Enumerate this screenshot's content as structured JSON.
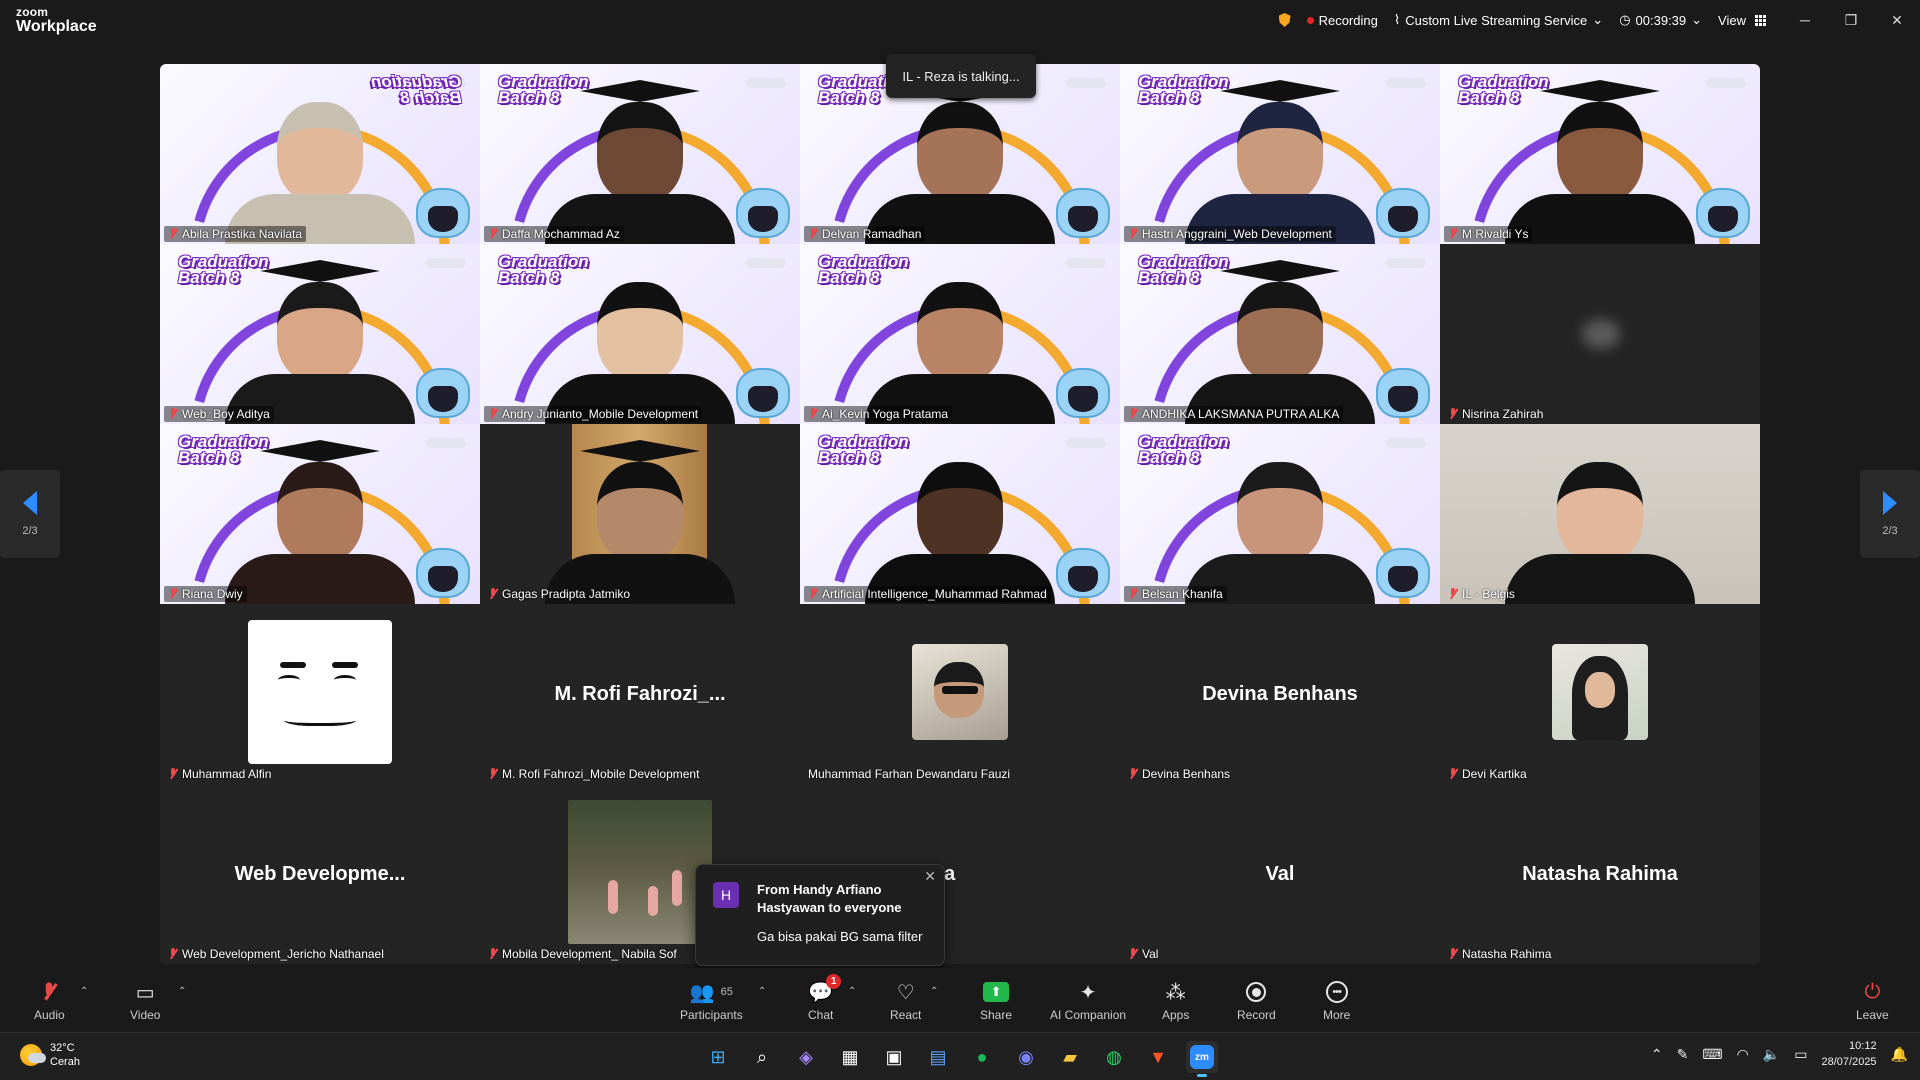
{
  "app": {
    "brand_top": "zoom",
    "brand_bottom": "Workplace"
  },
  "topbar": {
    "recording": "Recording",
    "streaming": "Custom Live Streaming Service",
    "timer": "00:39:39",
    "view": "View"
  },
  "talking_indicator": "IL - Reza is talking...",
  "video_badge": {
    "line1": "Graduation",
    "line2": "Batch 8"
  },
  "tiles": [
    {
      "name": "Abila Prastika Navilata",
      "kind": "video",
      "skin": "#e2b89a",
      "hair": "#c7c0b0",
      "cap": false,
      "flip": true
    },
    {
      "name": "Daffa Mochammad Az",
      "kind": "video",
      "skin": "#6e4a36",
      "hair": "#141414",
      "cap": true
    },
    {
      "name": "Delvan Ramadhan",
      "kind": "video",
      "skin": "#a57458",
      "hair": "#111111",
      "cap": true
    },
    {
      "name": "Hastri Anggraini_Web Development",
      "kind": "video",
      "skin": "#c99a7c",
      "hair": "#1f2540",
      "cap": true
    },
    {
      "name": "M Rivaldi Ys",
      "kind": "video",
      "skin": "#8a5a3e",
      "hair": "#111111",
      "cap": true
    },
    {
      "name": "Web_Boy Aditya",
      "kind": "video",
      "skin": "#d9a786",
      "hair": "#1a1a1a",
      "cap": true
    },
    {
      "name": "Andry Junianto_Mobile Development",
      "kind": "video",
      "skin": "#e2c0a0",
      "hair": "#111111",
      "cap": false
    },
    {
      "name": "Ai_Kevin Yoga Pratama",
      "kind": "video",
      "skin": "#b98466",
      "hair": "#111111",
      "cap": false
    },
    {
      "name": "ANDHIKA LAKSMANA PUTRA ALKA",
      "kind": "video",
      "skin": "#9c6e54",
      "hair": "#151515",
      "cap": true
    },
    {
      "name": "Nisrina Zahirah",
      "kind": "blank"
    },
    {
      "name": "Riana Dwiy",
      "kind": "video",
      "skin": "#b07a5c",
      "hair": "#2a1a18",
      "cap": true
    },
    {
      "name": "Gagas Pradipta Jatmiko",
      "kind": "wood",
      "skin": "#b4896a",
      "hair": "#111111",
      "cap": true
    },
    {
      "name": "Artificial Intelligence_Muhammad Rahmad",
      "kind": "video",
      "skin": "#4e3324",
      "hair": "#0e0e0e",
      "cap": false
    },
    {
      "name": "Belsan Khanifa",
      "kind": "video",
      "skin": "#c9957a",
      "hair": "#1b1b1b",
      "cap": false
    },
    {
      "name": "IL - Belgis",
      "kind": "photo",
      "skin": "#e3b79c",
      "hair": "#151515",
      "cap": false
    },
    {
      "name": "Muhammad Alfin",
      "kind": "avatar-face"
    },
    {
      "name": "M. Rofi Fahrozi_Mobile Development",
      "kind": "initials",
      "display": "M.  Rofi  Fahrozi_..."
    },
    {
      "name": "Muhammad Farhan Dewandaru Fauzi",
      "kind": "avatar-photo",
      "muted": false
    },
    {
      "name": "Devina Benhans",
      "kind": "initials",
      "display": "Devina Benhans"
    },
    {
      "name": "Devi Kartika",
      "kind": "avatar-hijab"
    },
    {
      "name": "Web Development_Jericho Nathanael",
      "kind": "initials",
      "display": "Web  Developme..."
    },
    {
      "name": "Mobila Development_ Nabila Sof",
      "kind": "avatar-garden"
    },
    {
      "name": "",
      "kind": "initials",
      "display": "t Tanjaya",
      "hide_plate": true
    },
    {
      "name": "Val",
      "kind": "initials",
      "display": "Val"
    },
    {
      "name": "Natasha Rahima",
      "kind": "initials",
      "display": "Natasha Rahima"
    }
  ],
  "pager": {
    "left": "2/3",
    "right": "2/3"
  },
  "chat_popup": {
    "avatar": "H",
    "from": "From Handy Arfiano Hastyawan to everyone",
    "message": "Ga bisa pakai BG sama filter"
  },
  "toolbar": {
    "audio": "Audio",
    "video": "Video",
    "participants": "Participants",
    "participants_count": "65",
    "chat": "Chat",
    "chat_badge": "1",
    "react": "React",
    "share": "Share",
    "ai_companion": "AI Companion",
    "apps": "Apps",
    "record": "Record",
    "more": "More",
    "leave": "Leave"
  },
  "taskbar": {
    "temp": "32°C",
    "weather": "Cerah",
    "time": "10:12",
    "date": "28/07/2025"
  }
}
